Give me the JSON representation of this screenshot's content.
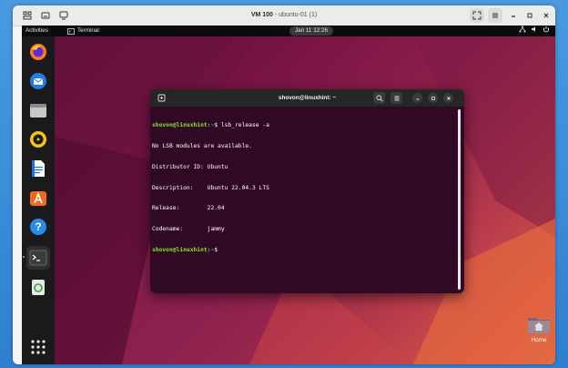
{
  "vm": {
    "title_bold": "VM 100",
    "title_rest": " - ubuntu-01 (1)"
  },
  "guest": {
    "activities": "Activities",
    "app_name": "Terminal",
    "clock": "Jan 11  12:26"
  },
  "terminal": {
    "title": "shovon@linuxhint: ~",
    "lines": [
      {
        "prompt": "shovon@linuxhint:",
        "path": "~",
        "sym": "$",
        "cmd": " lsb_release -a"
      },
      {
        "text": "No LSB modules are available."
      },
      {
        "text": "Distributor ID:\tUbuntu"
      },
      {
        "text": "Description:\tUbuntu 22.04.3 LTS"
      },
      {
        "text": "Release:\t22.04"
      },
      {
        "text": "Codename:\tjammy"
      },
      {
        "prompt": "shovon@linuxhint:",
        "path": "~",
        "sym": "$",
        "cmd": " "
      }
    ]
  },
  "desktop": {
    "home_label": "Home"
  },
  "dock": {
    "items": [
      "firefox-icon",
      "thunderbird-icon",
      "files-icon",
      "rhythmbox-icon",
      "writer-icon",
      "software-icon",
      "help-icon",
      "terminal-icon",
      "trash-icon",
      "show-apps-icon"
    ]
  },
  "colors": {
    "terminal_bg": "#300a24",
    "prompt": "#8ae234",
    "frame_blue": "#3b8ed8"
  }
}
